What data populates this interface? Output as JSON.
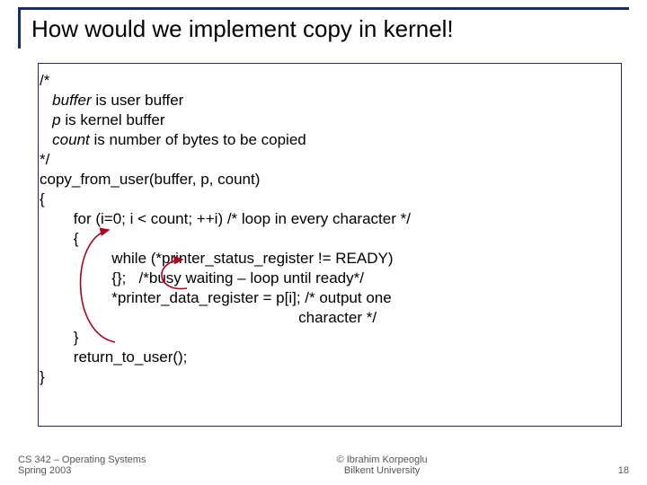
{
  "title": "How would we implement copy in kernel!",
  "code": {
    "c1": "/*",
    "buffer_word": "buffer",
    "buffer_desc": " is user buffer",
    "p_word": "p",
    "p_desc": " is kernel buffer",
    "count_word": "count",
    "count_desc": " is number of bytes to be copied",
    "c2": "*/",
    "fn": "copy_from_user(buffer, p, count)",
    "bo": "{",
    "for": "for (i=0; i < count; ++i) /* loop in every character */",
    "fbo": "{",
    "while": "while (*printer_status_register != READY)",
    "busy": "{};   /*busy waiting – loop until ready*/",
    "out": "*printer_data_register = p[i]; /* output one",
    "out2": "character */",
    "fbc": "}",
    "ret": "return_to_user();",
    "bc": "}"
  },
  "footer": {
    "left1": "CS 342 – Operating Systems",
    "left2": "Spring 2003",
    "center1": "© Ibrahim Korpeoglu",
    "center2": "Bilkent University",
    "right": "18"
  }
}
